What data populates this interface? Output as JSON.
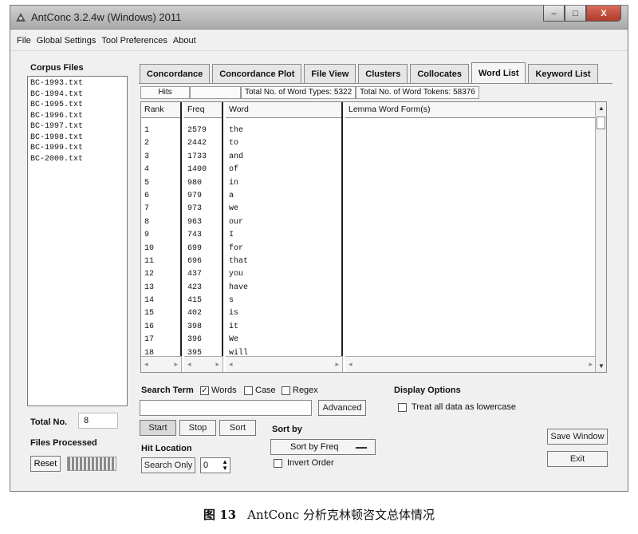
{
  "window": {
    "title": "AntConc 3.2.4w (Windows) 2011"
  },
  "window_controls": {
    "minimize": "–",
    "maximize": "□",
    "close": "X"
  },
  "menu": [
    "File",
    "Global Settings",
    "Tool Preferences",
    "About"
  ],
  "corpus": {
    "title": "Corpus Files",
    "files": [
      "BC-1993.txt",
      "BC-1994.txt",
      "BC-1995.txt",
      "BC-1996.txt",
      "BC-1997.txt",
      "BC-1998.txt",
      "BC-1999.txt",
      "BC-2000.txt"
    ],
    "total_label": "Total No.",
    "total_value": "8",
    "files_processed_label": "Files Processed",
    "reset_label": "Reset"
  },
  "tabs": [
    {
      "label": "Concordance",
      "active": false
    },
    {
      "label": "Concordance Plot",
      "active": false
    },
    {
      "label": "File View",
      "active": false
    },
    {
      "label": "Clusters",
      "active": false
    },
    {
      "label": "Collocates",
      "active": false
    },
    {
      "label": "Word List",
      "active": true
    },
    {
      "label": "Keyword List",
      "active": false
    }
  ],
  "wordlist": {
    "hits_label": "Hits",
    "total_types": "Total No. of Word Types: 5322",
    "total_tokens": "Total No. of Word Tokens: 58376",
    "headers": {
      "rank": "Rank",
      "freq": "Freq",
      "word": "Word",
      "lemma": "Lemma Word Form(s)"
    },
    "rows": [
      {
        "rank": "1",
        "freq": "2579",
        "word": "the"
      },
      {
        "rank": "2",
        "freq": "2442",
        "word": "to"
      },
      {
        "rank": "3",
        "freq": "1733",
        "word": "and"
      },
      {
        "rank": "4",
        "freq": "1400",
        "word": "of"
      },
      {
        "rank": "5",
        "freq": "980",
        "word": "in"
      },
      {
        "rank": "6",
        "freq": "979",
        "word": "a"
      },
      {
        "rank": "7",
        "freq": "973",
        "word": "we"
      },
      {
        "rank": "8",
        "freq": "963",
        "word": "our"
      },
      {
        "rank": "9",
        "freq": "743",
        "word": "I"
      },
      {
        "rank": "10",
        "freq": "699",
        "word": "for"
      },
      {
        "rank": "11",
        "freq": "696",
        "word": "that"
      },
      {
        "rank": "12",
        "freq": "437",
        "word": "you"
      },
      {
        "rank": "13",
        "freq": "423",
        "word": "have"
      },
      {
        "rank": "14",
        "freq": "415",
        "word": "s"
      },
      {
        "rank": "15",
        "freq": "402",
        "word": "is"
      },
      {
        "rank": "16",
        "freq": "398",
        "word": "it"
      },
      {
        "rank": "17",
        "freq": "396",
        "word": "We"
      },
      {
        "rank": "18",
        "freq": "395",
        "word": "will"
      }
    ]
  },
  "search": {
    "label": "Search Term",
    "words_label": "Words",
    "words_checked": true,
    "case_label": "Case",
    "case_checked": false,
    "regex_label": "Regex",
    "regex_checked": false,
    "value": "",
    "advanced_label": "Advanced",
    "start_label": "Start",
    "stop_label": "Stop",
    "sort_label": "Sort"
  },
  "sort_by": {
    "label": "Sort by",
    "selected": "Sort by Freq",
    "invert_label": "Invert Order",
    "invert_checked": false
  },
  "hit_location": {
    "label": "Hit Location",
    "search_only_label": "Search Only",
    "value": "0"
  },
  "display_options": {
    "label": "Display Options",
    "lowercase_label": "Treat all data as lowercase",
    "lowercase_checked": false
  },
  "buttons": {
    "save_window": "Save Window",
    "exit": "Exit"
  },
  "caption": {
    "number": "图 13",
    "text": "AntConc 分析克林顿咨文总体情况"
  }
}
